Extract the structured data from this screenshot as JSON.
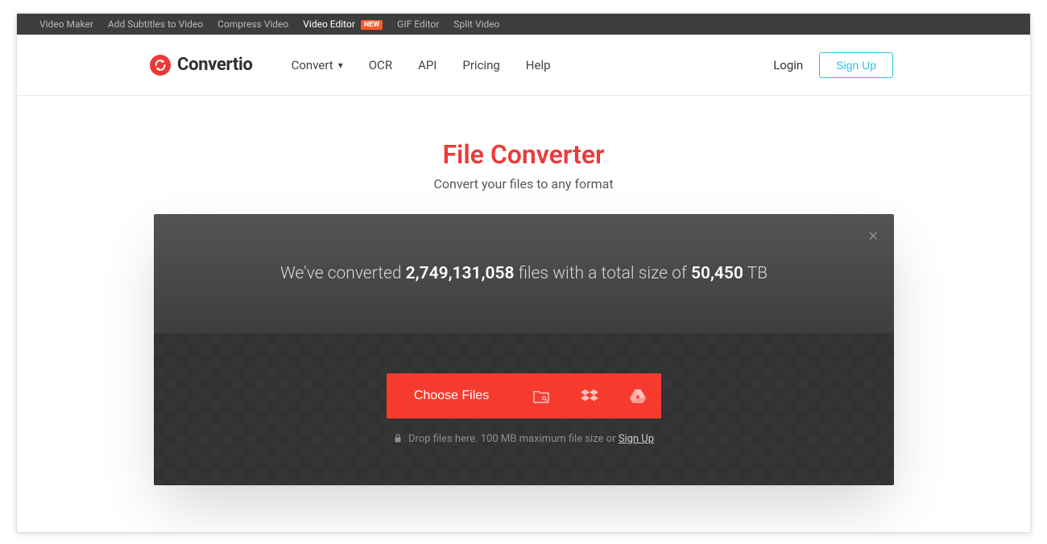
{
  "topbar": {
    "items": [
      {
        "label": "Video Maker"
      },
      {
        "label": "Add Subtitles to Video"
      },
      {
        "label": "Compress Video"
      },
      {
        "label": "Video Editor",
        "active": true,
        "badge": "NEW"
      },
      {
        "label": "GIF Editor"
      },
      {
        "label": "Split Video"
      }
    ]
  },
  "brand": {
    "name": "Convertio"
  },
  "nav": {
    "convert": "Convert",
    "ocr": "OCR",
    "api": "API",
    "pricing": "Pricing",
    "help": "Help"
  },
  "auth": {
    "login": "Login",
    "signup": "Sign Up"
  },
  "hero": {
    "title": "File Converter",
    "subtitle": "Convert your files to any format"
  },
  "panel": {
    "stats_prefix": "We've converted ",
    "files_count": "2,749,131,058",
    "stats_mid": " files with a total size of ",
    "total_size": "50,450",
    "size_unit": " TB"
  },
  "uploader": {
    "choose_label": "Choose Files",
    "subline_prefix": "Drop files here. 100 MB maximum file size or ",
    "signup": "Sign Up"
  }
}
